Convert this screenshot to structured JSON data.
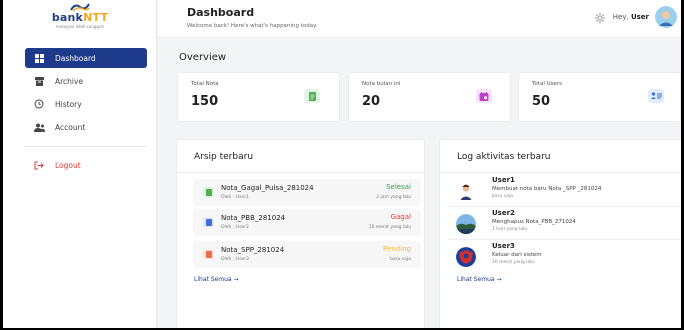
{
  "brand": {
    "name_main": "bank",
    "name_accent": "NTT",
    "tagline": "melayani lebih sungguh"
  },
  "sidebar": {
    "items": [
      {
        "label": "Dashboard",
        "icon": "dashboard-grid-icon",
        "active": true
      },
      {
        "label": "Archive",
        "icon": "archive-box-icon",
        "active": false
      },
      {
        "label": "History",
        "icon": "history-clock-icon",
        "active": false
      },
      {
        "label": "Account",
        "icon": "account-users-icon",
        "active": false
      }
    ],
    "logout_label": "Logout"
  },
  "header": {
    "title": "Dashboard",
    "subtitle": "Welcome back! Here's what's happening today.",
    "greeting_prefix": "Hey,",
    "user_name": "User"
  },
  "overview": {
    "title": "Overview",
    "stats": [
      {
        "label": "Total Nota",
        "value": "150",
        "icon_color": "#4caf50",
        "icon_bg": "#e3f5e4"
      },
      {
        "label": "Nota bulan ini",
        "value": "20",
        "icon_color": "#c040c8",
        "icon_bg": "#f7e3f8"
      },
      {
        "label": "Total Users",
        "value": "50",
        "icon_color": "#2f6fe0",
        "icon_bg": "#e3ecfb"
      }
    ]
  },
  "arsip": {
    "title": "Arsip terbaru",
    "items": [
      {
        "name": "Nota_Gagal_Pulsa_281024",
        "by": "Oleh : User1",
        "status": "Selesai",
        "status_color": "#2e9e4d",
        "time": "2 jam yang lalu",
        "icon_color": "#4caf50",
        "icon_bg": "#dff3e1"
      },
      {
        "name": "Nota_PBB_281024",
        "by": "Oleh : User2",
        "status": "Gagal",
        "status_color": "#e53935",
        "time": "10 menit yang lalu",
        "icon_color": "#3b6fe0",
        "icon_bg": "#e0e9fb"
      },
      {
        "name": "Nota_SPP_281024",
        "by": "Oleh : User3",
        "status": "Pending",
        "status_color": "#f5b942",
        "time": "baru saja",
        "icon_color": "#ef6c4a",
        "icon_bg": "#fde6df"
      }
    ],
    "see_all": "Lihat Semua →"
  },
  "log": {
    "title": "Log aktivitas terbaru",
    "items": [
      {
        "user": "User1",
        "action": "Membuat nota baru Nota _SPP _281024",
        "time": "baru saja"
      },
      {
        "user": "User2",
        "action": "Menghapus Nota_PBB_271024",
        "time": "1 hari yang lalu"
      },
      {
        "user": "User3",
        "action": "Keluar dari sistem",
        "time": "10 menit yang lalu"
      }
    ],
    "see_all": "Lihat Semua →"
  },
  "colors": {
    "primary": "#1e3a8a",
    "danger": "#e53935"
  }
}
